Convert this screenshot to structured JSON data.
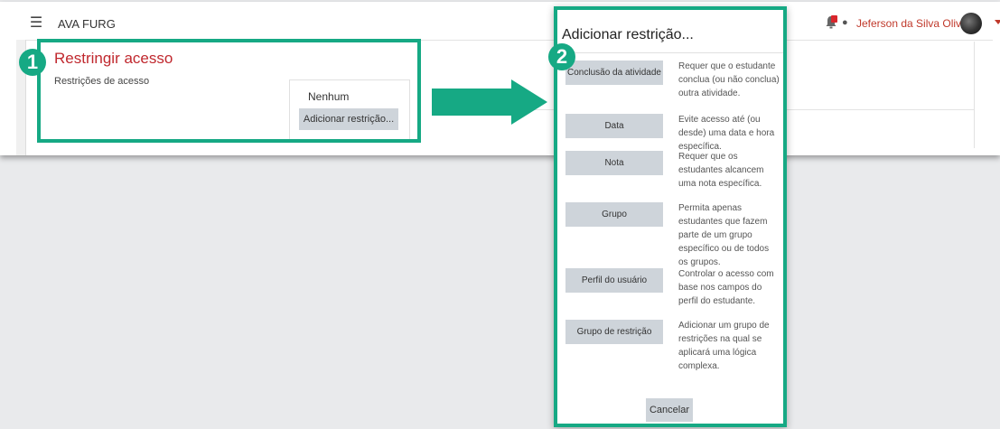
{
  "header": {
    "menu_icon": "hamburger-icon",
    "brand": "AVA FURG",
    "notification_icon": "bell-icon",
    "chat_icon": "speech-bubble-icon",
    "user_name": "Jeferson da Silva Oliveira",
    "avatar_icon": "user-avatar"
  },
  "step1": {
    "badge": "1",
    "title": "Restringir acesso",
    "restrictions_label": "Restrições de acesso",
    "none_text": "Nenhum",
    "add_button": "Adicionar restrição..."
  },
  "step2": {
    "badge": "2",
    "dialog_title": "Adicionar restrição...",
    "options": [
      {
        "label": "Conclusão da atividade",
        "desc": "Requer que o estudante conclua (ou não conclua) outra atividade."
      },
      {
        "label": "Data",
        "desc": "Evite acesso até (ou desde) uma data e hora específica."
      },
      {
        "label": "Nota",
        "desc": "Requer que os estudantes alcancem uma nota específica."
      },
      {
        "label": "Grupo",
        "desc": "Permita apenas estudantes que fazem parte de um grupo específico ou de todos os grupos."
      },
      {
        "label": "Perfil do usuário",
        "desc": "Controlar o acesso com base nos campos do perfil do estudante."
      },
      {
        "label": "Grupo de restrição",
        "desc": "Adicionar um grupo de restrições na qual se aplicará uma lógica complexa."
      }
    ],
    "cancel": "Cancelar"
  },
  "colors": {
    "highlight": "#16a984",
    "title_red": "#c0282e",
    "user_red": "#c0392b",
    "button_gray": "#ced4da"
  }
}
